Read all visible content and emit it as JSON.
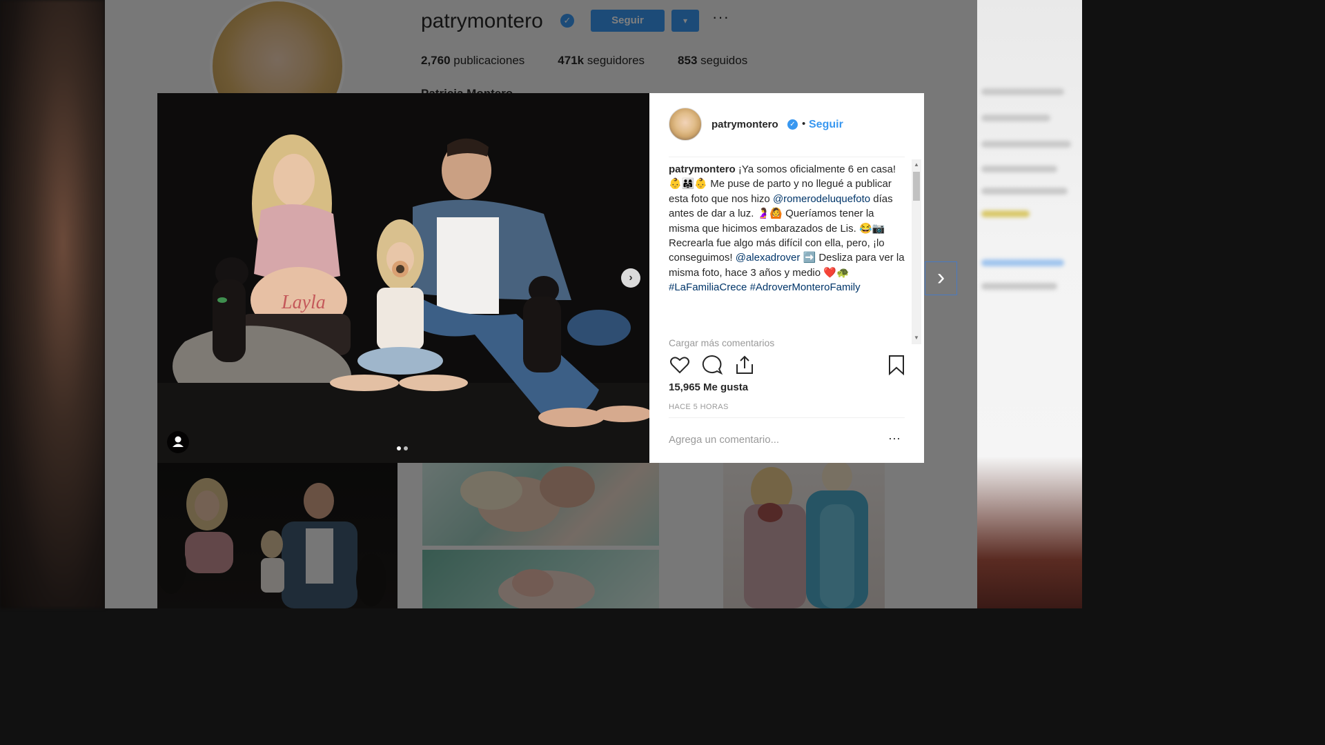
{
  "profile": {
    "username": "patrymontero",
    "follow_label": "Seguir",
    "dropdown_glyph": "▾",
    "more_glyph": "···",
    "posts_count": "2,760",
    "posts_label": "publicaciones",
    "followers_count": "471k",
    "followers_label": "seguidores",
    "following_count": "853",
    "following_label": "seguidos",
    "full_name": "Patricia Montero"
  },
  "post": {
    "username": "patrymontero",
    "separator": "•",
    "follow_label": "Seguir",
    "caption_user": "patrymontero",
    "caption_1": " ¡Ya somos oficialmente 6 en casa! 👶👨‍👩‍👧👶 Me puse de parto y no llegué a publicar esta foto que nos hizo ",
    "mention_1": "@romerodeluquefoto",
    "caption_2": " días antes de dar a luz. 🤰🙆 Queríamos tener la misma que hicimos embarazados de Lis. 😂📷 Recrearla fue algo más difícil con ella, pero, ¡lo conseguimos! ",
    "mention_2": "@alexadrover",
    "caption_3": " ➡️ Desliza para ver la misma foto, hace 3 años y medio ❤️🐢 ",
    "hashtag_1": "#LaFamiliaCrece",
    "hashtag_2": "#AdroverMonteroFamily",
    "load_more": "Cargar más comentarios",
    "likes": "15,965 Me gusta",
    "time": "HACE 5 HORAS",
    "comment_placeholder": "Agrega un comentario...",
    "comment_more": "···",
    "belly_text": "Layla",
    "carousel_position": 1,
    "carousel_total": 2
  },
  "icons": {
    "verified": "✓",
    "next_inline": "›",
    "next_modal": "›",
    "scroll_up": "▲",
    "scroll_down": "▼"
  },
  "colors": {
    "accent": "#3897f0",
    "text": "#262626",
    "muted": "#999999",
    "link": "#003569"
  }
}
